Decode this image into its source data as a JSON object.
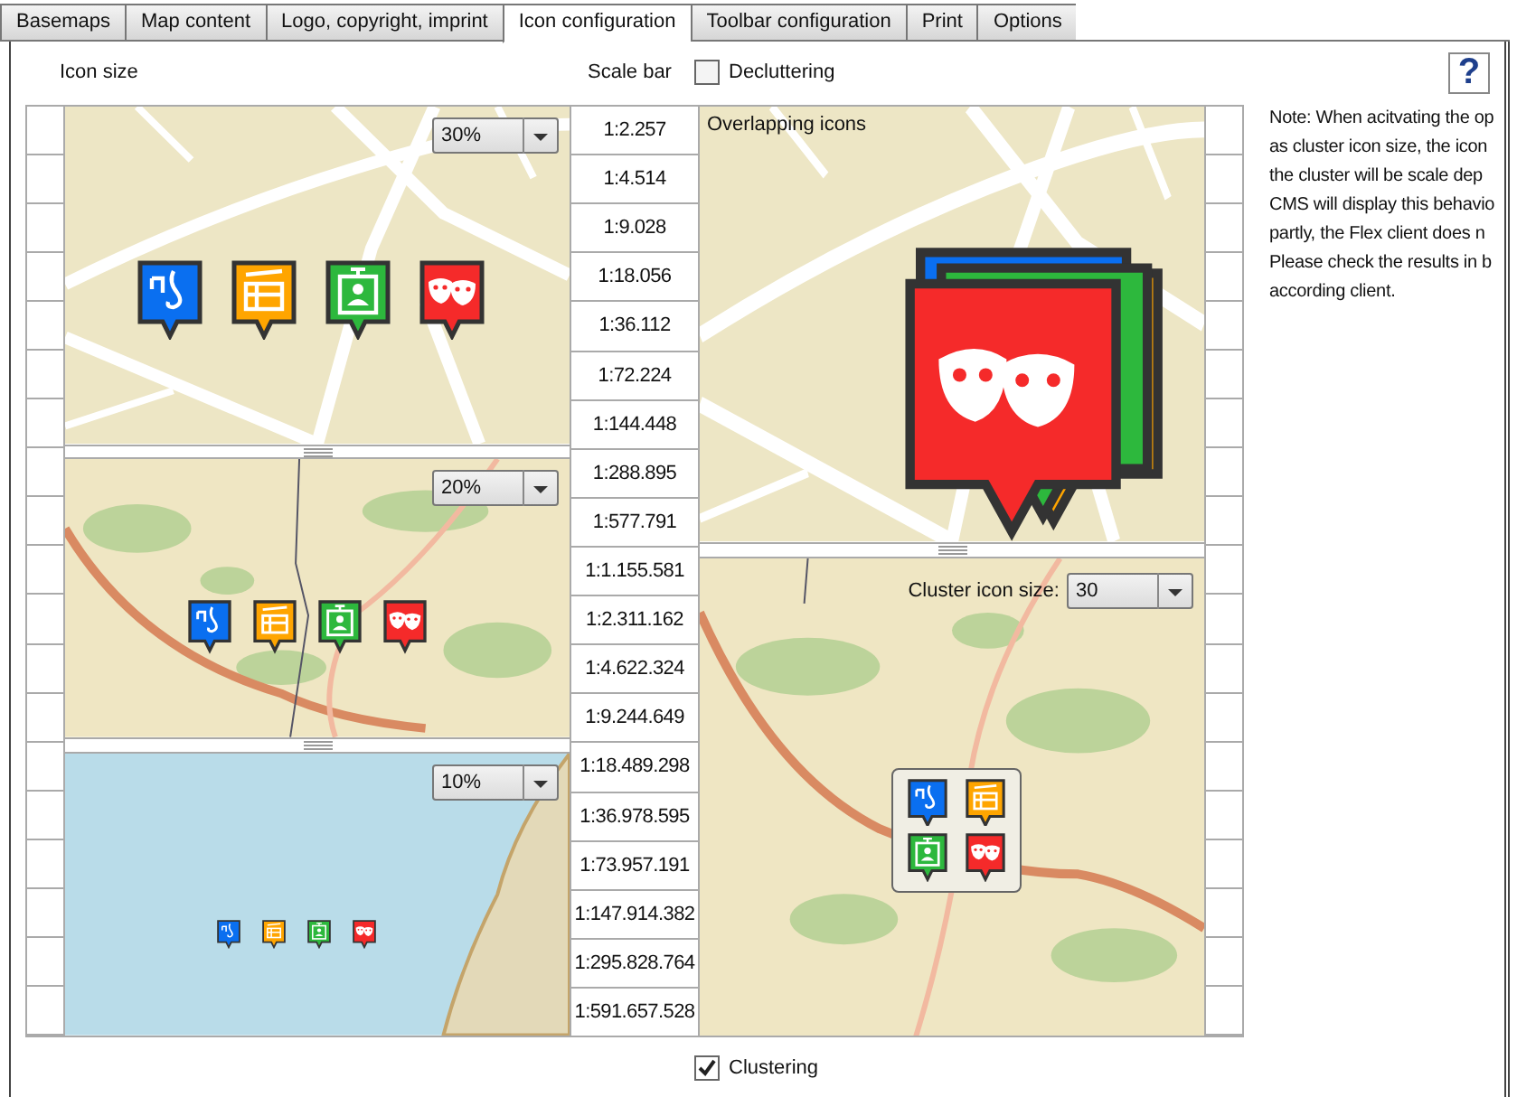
{
  "tabs": [
    {
      "label": "Basemaps",
      "selected": false
    },
    {
      "label": "Map content",
      "selected": false
    },
    {
      "label": "Logo, copyright, imprint",
      "selected": false
    },
    {
      "label": "Icon configuration",
      "selected": true
    },
    {
      "label": "Toolbar configuration",
      "selected": false
    },
    {
      "label": "Print",
      "selected": false
    },
    {
      "label": "Options",
      "selected": false
    }
  ],
  "header": {
    "icon_size_label": "Icon size",
    "scale_bar_label": "Scale bar",
    "decluttering": {
      "label": "Decluttering",
      "checked": false
    },
    "help": "?"
  },
  "poi_icons": [
    {
      "kind": "music",
      "color": "#0a6ff0"
    },
    {
      "kind": "film",
      "color": "#ffa500"
    },
    {
      "kind": "portrait",
      "color": "#2db83d"
    },
    {
      "kind": "theater",
      "color": "#f52a2a"
    }
  ],
  "icon_size_maps": [
    {
      "kind": "street",
      "size": "30%"
    },
    {
      "kind": "terrain",
      "size": "20%"
    },
    {
      "kind": "ocean",
      "size": "10%"
    }
  ],
  "scales": [
    "1:2.257",
    "1:4.514",
    "1:9.028",
    "1:18.056",
    "1:36.112",
    "1:72.224",
    "1:144.448",
    "1:288.895",
    "1:577.791",
    "1:1.155.581",
    "1:2.311.162",
    "1:4.622.324",
    "1:9.244.649",
    "1:18.489.298",
    "1:36.978.595",
    "1:73.957.191",
    "1:147.914.382",
    "1:295.828.764",
    "1:591.657.528"
  ],
  "overlap_map": {
    "label": "Overlapping icons"
  },
  "cluster_map": {
    "label": "Cluster icon size:",
    "size": "30"
  },
  "note": [
    "Note: When acitvating the op",
    "as cluster icon size, the icon",
    "the cluster will be scale dep",
    "CMS will display this behavio",
    "partly, the Flex client does n",
    "Please check the results in b",
    "according client."
  ],
  "clustering": {
    "label": "Clustering",
    "checked": true
  }
}
